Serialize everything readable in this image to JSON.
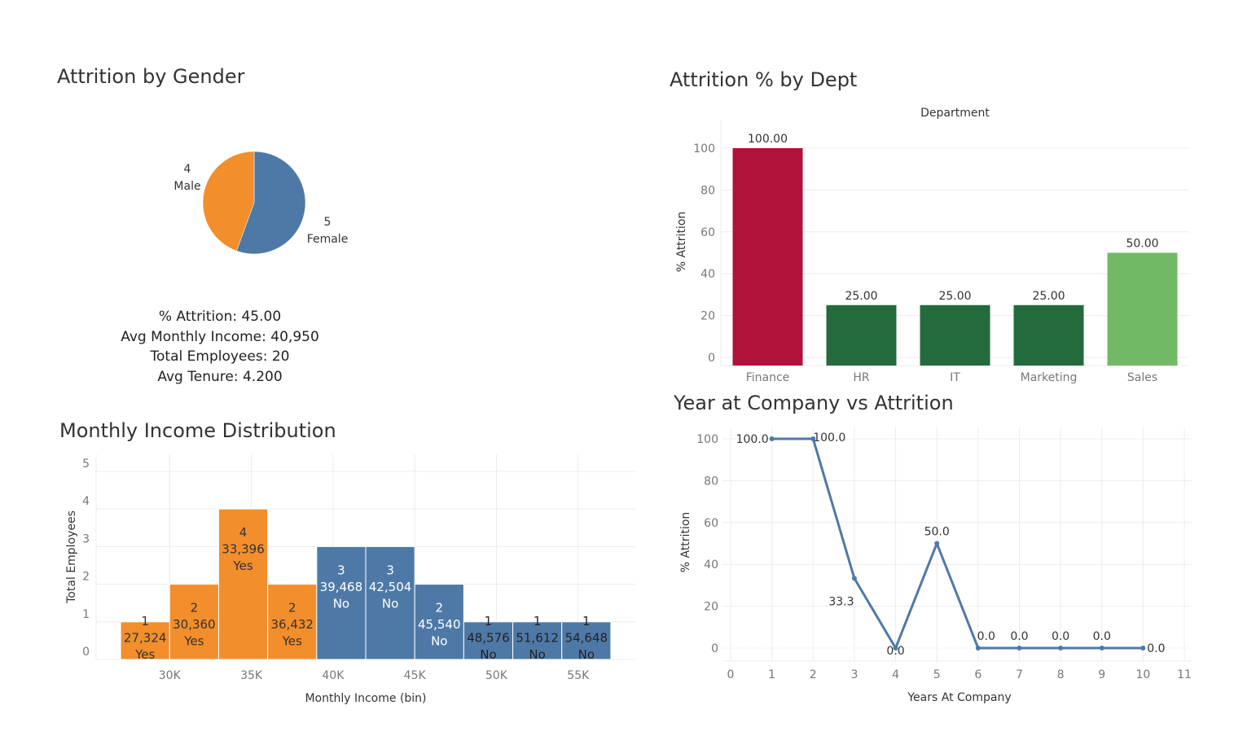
{
  "gender_panel": {
    "title": "Attrition by Gender",
    "kpis": {
      "attrition_label": "% Attrition:",
      "attrition_value": "45.00",
      "income_label": "Avg Monthly Income:",
      "income_value": "40,950",
      "employees_label": "Total Employees:",
      "employees_value": "20",
      "tenure_label": "Avg Tenure:",
      "tenure_value": "4.200"
    }
  },
  "dept_panel": {
    "title": "Attrition % by Dept"
  },
  "income_panel": {
    "title": "Monthly Income Distribution"
  },
  "years_panel": {
    "title": "Year at Company vs Attrition"
  },
  "chart_data": [
    {
      "type": "pie",
      "title": "Attrition by Gender",
      "slices": [
        {
          "label": "Female",
          "value": 5,
          "color": "#4e79a7"
        },
        {
          "label": "Male",
          "value": 4,
          "color": "#f28e2b"
        }
      ]
    },
    {
      "type": "bar",
      "title": "Attrition % by Dept",
      "header": "Department",
      "ylabel": "% Attrition",
      "ylim": [
        0,
        100
      ],
      "yticks": [
        0,
        20,
        40,
        60,
        80,
        100
      ],
      "categories": [
        "Finance",
        "HR",
        "IT",
        "Marketing",
        "Sales"
      ],
      "values": [
        100,
        25,
        25,
        25,
        50
      ],
      "value_labels": [
        "100.00",
        "25.00",
        "25.00",
        "25.00",
        "50.00"
      ],
      "colors": [
        "#b0123a",
        "#236b3c",
        "#236b3c",
        "#236b3c",
        "#72b966"
      ],
      "grid": true
    },
    {
      "type": "bar",
      "title": "Monthly Income Distribution",
      "xlabel": "Monthly Income (bin)",
      "ylabel": "Total Employees",
      "ylim": [
        0,
        5
      ],
      "yticks": [
        0,
        1,
        2,
        3,
        4,
        5
      ],
      "xlim": [
        25500,
        58500
      ],
      "xticks": [
        30000,
        35000,
        40000,
        45000,
        50000,
        55000
      ],
      "xtick_labels": [
        "30K",
        "35K",
        "40K",
        "45K",
        "50K",
        "55K"
      ],
      "bin_width": 3000,
      "bins": [
        {
          "start": 27000,
          "count": 1,
          "avg_income": "27,324",
          "attrition": "Yes"
        },
        {
          "start": 30000,
          "count": 2,
          "avg_income": "30,360",
          "attrition": "Yes"
        },
        {
          "start": 33000,
          "count": 4,
          "avg_income": "33,396",
          "attrition": "Yes"
        },
        {
          "start": 36000,
          "count": 2,
          "avg_income": "36,432",
          "attrition": "Yes"
        },
        {
          "start": 39000,
          "count": 3,
          "avg_income": "39,468",
          "attrition": "No"
        },
        {
          "start": 42000,
          "count": 3,
          "avg_income": "42,504",
          "attrition": "No"
        },
        {
          "start": 45000,
          "count": 2,
          "avg_income": "45,540",
          "attrition": "No"
        },
        {
          "start": 48000,
          "count": 1,
          "avg_income": "48,576",
          "attrition": "No"
        },
        {
          "start": 51000,
          "count": 1,
          "avg_income": "51,612",
          "attrition": "No"
        },
        {
          "start": 54000,
          "count": 1,
          "avg_income": "54,648",
          "attrition": "No"
        }
      ],
      "colors": {
        "Yes": "#f28e2b",
        "No": "#4e79a7"
      },
      "grid": true
    },
    {
      "type": "line",
      "title": "Year at Company vs Attrition",
      "xlabel": "Years At Company",
      "ylabel": "% Attrition",
      "xlim": [
        0,
        11
      ],
      "ylim": [
        0,
        100
      ],
      "xticks": [
        0,
        1,
        2,
        3,
        4,
        5,
        6,
        7,
        8,
        9,
        10,
        11
      ],
      "yticks": [
        0,
        20,
        40,
        60,
        80,
        100
      ],
      "x": [
        1,
        2,
        3,
        4,
        5,
        6,
        7,
        8,
        9,
        10
      ],
      "y": [
        100,
        100,
        33.3,
        0,
        50,
        0,
        0,
        0,
        0,
        0
      ],
      "point_labels": [
        "100.0",
        "100.0",
        "33.3",
        "0.0",
        "50.0",
        "0.0",
        "0.0",
        "0.0",
        "0.0",
        "0.0"
      ],
      "color": "#4e79a7",
      "grid": true
    }
  ]
}
